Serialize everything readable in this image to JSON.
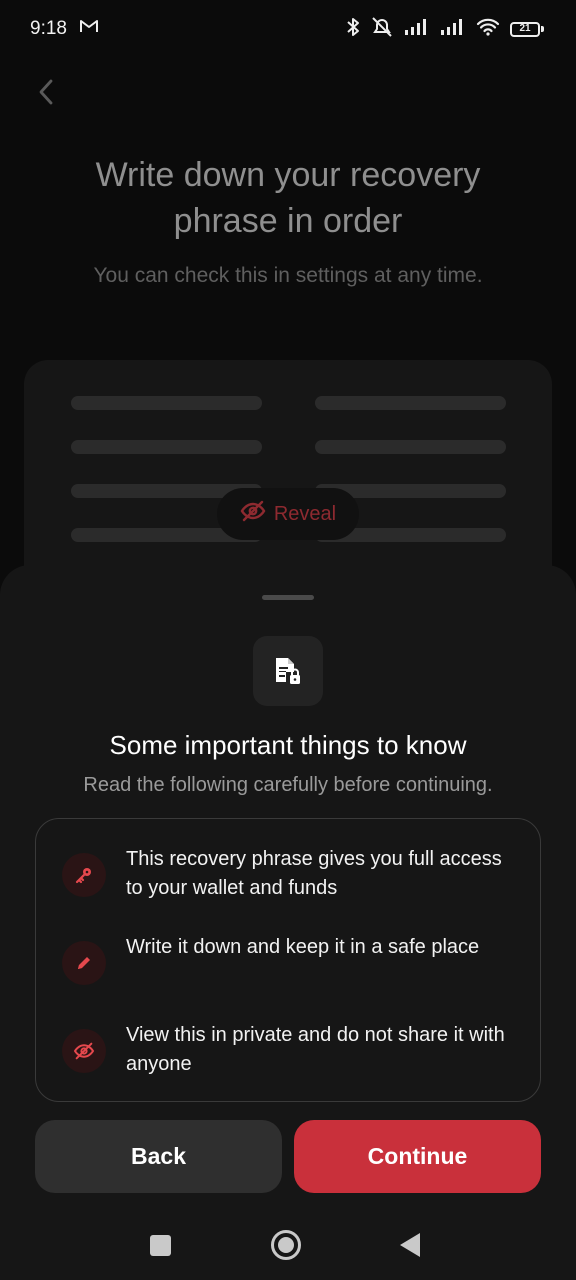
{
  "status_bar": {
    "time": "9:18",
    "battery_level": "21",
    "icons": [
      "gmail-icon",
      "bluetooth-icon",
      "mute-icon",
      "signal-icon",
      "signal-icon",
      "wifi-icon",
      "battery-icon"
    ]
  },
  "page": {
    "title": "Write down your recovery phrase in order",
    "subtitle": "You can check this in settings at any time.",
    "reveal_label": "Reveal"
  },
  "sheet": {
    "title": "Some important things to know",
    "subtitle": "Read the following carefully before continuing.",
    "items": [
      {
        "icon": "key-icon",
        "text": "This recovery phrase gives you full access to your wallet and funds"
      },
      {
        "icon": "pencil-icon",
        "text": "Write it down and keep it in a safe place"
      },
      {
        "icon": "eye-off-icon",
        "text": "View this in private and do not share it with anyone"
      }
    ],
    "back_label": "Back",
    "continue_label": "Continue"
  },
  "colors": {
    "accent": "#c9303b",
    "background": "#0b0b0b",
    "sheet": "#161616"
  }
}
